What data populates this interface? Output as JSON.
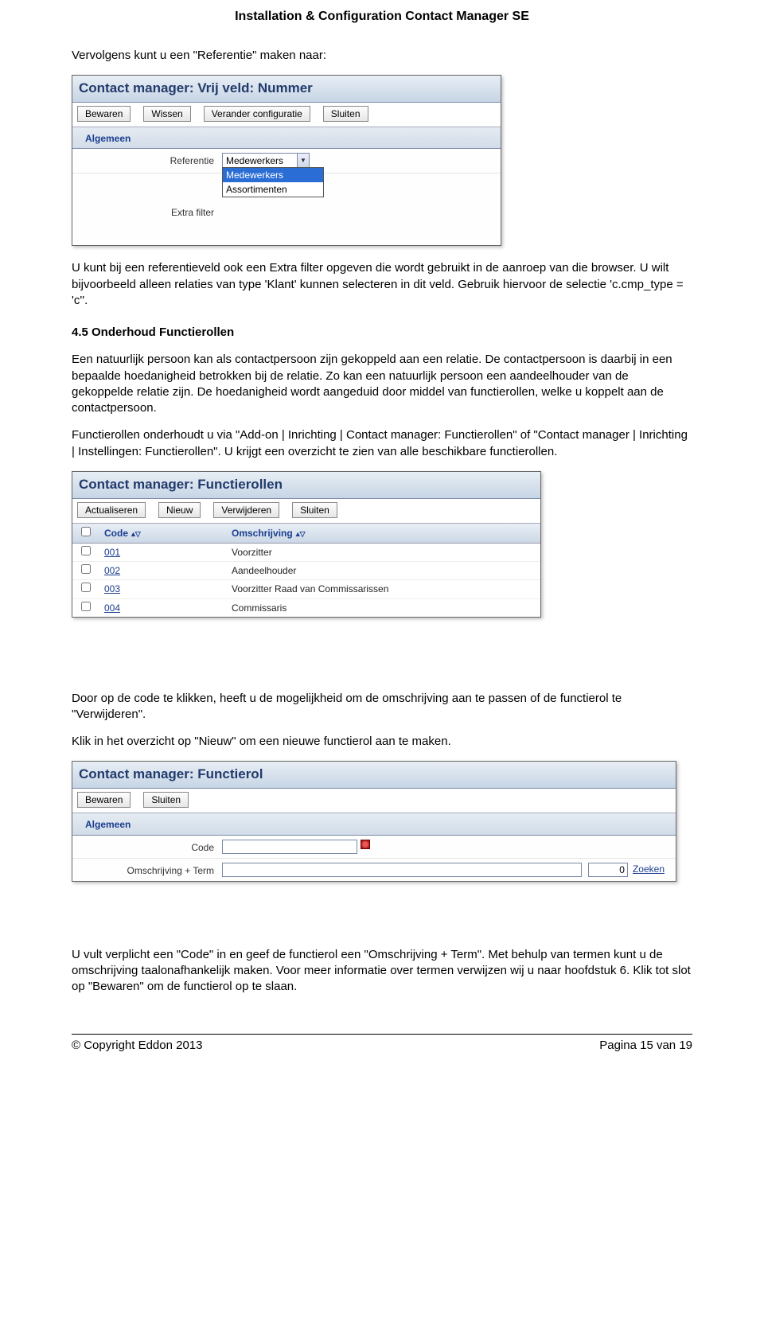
{
  "doc_header": "Installation & Configuration Contact Manager SE",
  "para_intro": "Vervolgens kunt u een \"Referentie\" maken naar:",
  "panel1": {
    "title": "Contact manager: Vrij veld: Nummer",
    "buttons": [
      "Bewaren",
      "Wissen",
      "Verander configuratie",
      "Sluiten"
    ],
    "tab": "Algemeen",
    "row1_label": "Referentie",
    "row1_value": "Medewerkers",
    "dropdown_opts": [
      "Medewerkers",
      "Assortimenten"
    ],
    "row2_label": "Extra filter"
  },
  "para_after_panel1": "U kunt bij een referentieveld ook een Extra filter opgeven die wordt gebruikt in de aanroep van die browser. U wilt bijvoorbeeld alleen relaties van type 'Klant' kunnen selecteren in dit veld. Gebruik hiervoor de selectie 'c.cmp_type = 'c''.",
  "section_4_5_title": "4.5   Onderhoud Functierollen",
  "para_4_5_a": "Een natuurlijk persoon kan als contactpersoon zijn gekoppeld aan een relatie. De contactpersoon is daarbij in een bepaalde hoedanigheid betrokken bij de relatie. Zo kan een natuurlijk persoon een aandeelhouder van de gekoppelde relatie zijn. De hoedanigheid wordt aangeduid door middel van functierollen, welke u koppelt aan de contactpersoon.",
  "para_4_5_b": "Functierollen onderhoudt u via \"Add-on | Inrichting | Contact manager: Functierollen\" of \"Contact manager | Inrichting | Instellingen: Functierollen\". U krijgt een overzicht te zien van alle beschikbare functierollen.",
  "panel2": {
    "title": "Contact manager: Functierollen",
    "buttons": [
      "Actualiseren",
      "Nieuw",
      "Verwijderen",
      "Sluiten"
    ],
    "col_code": "Code",
    "col_desc": "Omschrijving",
    "rows": [
      {
        "code": "001",
        "desc": "Voorzitter"
      },
      {
        "code": "002",
        "desc": "Aandeelhouder"
      },
      {
        "code": "003",
        "desc": "Voorzitter Raad van Commissarissen"
      },
      {
        "code": "004",
        "desc": "Commissaris"
      }
    ]
  },
  "para_after_panel2_a": "Door op de code te klikken, heeft u de mogelijkheid om de omschrijving aan te passen of de functierol te \"Verwijderen\".",
  "para_after_panel2_b": "Klik in het overzicht op \"Nieuw\" om een nieuwe functierol aan te maken.",
  "panel3": {
    "title": "Contact manager: Functierol",
    "buttons": [
      "Bewaren",
      "Sluiten"
    ],
    "tab": "Algemeen",
    "row1_label": "Code",
    "row2_label": "Omschrijving + Term",
    "row2_term_value": "0",
    "row2_link": "Zoeken"
  },
  "para_after_panel3": "U vult verplicht een \"Code\" in en geef de functierol een \"Omschrijving + Term\". Met behulp van termen kunt u de omschrijving taalonafhankelijk maken. Voor meer informatie over termen verwijzen wij u naar hoofdstuk 6. Klik tot slot op \"Bewaren\" om de functierol op te slaan.",
  "footer_left": "© Copyright Eddon 2013",
  "footer_right": "Pagina 15 van 19"
}
